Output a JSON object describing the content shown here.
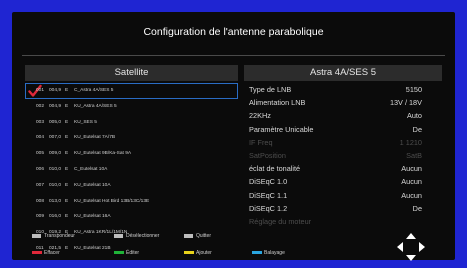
{
  "title": "Configuration de l'antenne parabolique",
  "left_header": "Satellite",
  "right_header": "Astra 4A/SES 5",
  "satellites": [
    {
      "num": "001",
      "freq": "004,9",
      "band": "E",
      "name": "C_Astra 4A/SES 5"
    },
    {
      "num": "002",
      "freq": "004,9",
      "band": "E",
      "name": "KU_Astra 4A/SES 5"
    },
    {
      "num": "003",
      "freq": "005,0",
      "band": "E",
      "name": "KU_SES 5"
    },
    {
      "num": "004",
      "freq": "007,0",
      "band": "E",
      "name": "KU_Eutelsat 7A/7B"
    },
    {
      "num": "005",
      "freq": "009,0",
      "band": "E",
      "name": "KU_Eutelsat 9B/Ka-Sat 9A"
    },
    {
      "num": "006",
      "freq": "010,0",
      "band": "E",
      "name": "C_Eutelsat 10A"
    },
    {
      "num": "007",
      "freq": "010,0",
      "band": "E",
      "name": "KU_Eutelsat 10A"
    },
    {
      "num": "008",
      "freq": "013,0",
      "band": "E",
      "name": "KU_Eutelsat Hot Bird 13B/13C/13E"
    },
    {
      "num": "009",
      "freq": "016,0",
      "band": "E",
      "name": "KU_Eutelsat 16A"
    },
    {
      "num": "010",
      "freq": "019,2",
      "band": "E",
      "name": "KU_Astra 1KR/1L/1M/1N"
    },
    {
      "num": "011",
      "freq": "021,5",
      "band": "E",
      "name": "KU_Eutelsat 21B"
    }
  ],
  "params": [
    {
      "label": "Type de LNB",
      "value": "5150",
      "disabled": false
    },
    {
      "label": "Alimentation LNB",
      "value": "13V / 18V",
      "disabled": false
    },
    {
      "label": "22KHz",
      "value": "Auto",
      "disabled": false
    },
    {
      "label": "Paramètre Unicable",
      "value": "De",
      "disabled": false
    },
    {
      "label": "IF Freq",
      "value": "1 1210",
      "disabled": true
    },
    {
      "label": "SatPosition",
      "value": "SatB",
      "disabled": true
    },
    {
      "label": "éclat de tonalité",
      "value": "Aucun",
      "disabled": false
    },
    {
      "label": "DiSEqC 1.0",
      "value": "Aucun",
      "disabled": false
    },
    {
      "label": "DiSEqC 1.1",
      "value": "Aucun",
      "disabled": false
    },
    {
      "label": "DiSEqC 1.2",
      "value": "De",
      "disabled": false
    },
    {
      "label": "Réglage du moteur",
      "value": "",
      "disabled": true
    }
  ],
  "legend": {
    "transpondeur": "Transpondeur",
    "deselectionner": "Désélectionner",
    "quitter": "Quitter",
    "effacer": "Effacer",
    "editer": "Éditer",
    "ajouter": "Ajouter",
    "balayage": "Balayage"
  },
  "colors": {
    "red": "#e0283a",
    "green": "#1fb338",
    "yellow": "#e8d21b",
    "blue": "#2aa5e0",
    "check": "#e0283a",
    "selection": "#2a6cc4"
  },
  "icons": {
    "check": "check-icon",
    "nav": "dpad-arrows-icon"
  }
}
